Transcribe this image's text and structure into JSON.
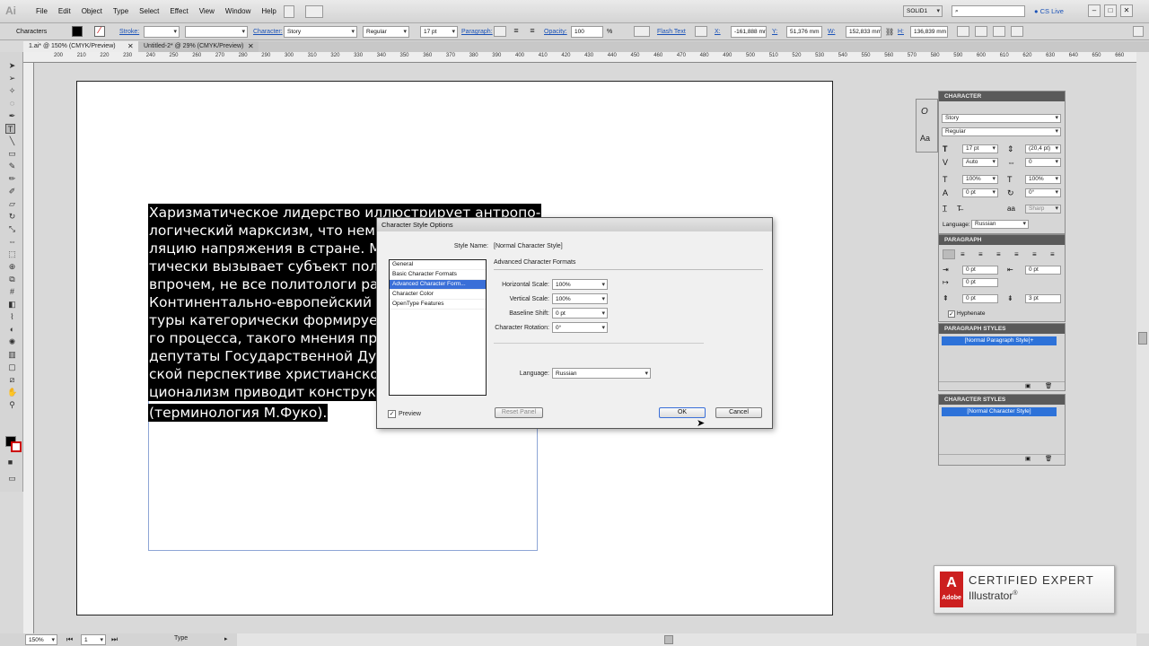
{
  "menubar": {
    "logo": "Ai",
    "items": [
      "File",
      "Edit",
      "Object",
      "Type",
      "Select",
      "Effect",
      "View",
      "Window",
      "Help"
    ],
    "workspace": "SOLID1",
    "cs_live": "CS Live"
  },
  "control": {
    "label": "Characters",
    "stroke": "Stroke:",
    "character": "Character:",
    "font": "Story",
    "style": "Regular",
    "size": "17 pt",
    "paragraph": "Paragraph:",
    "opacity_label": "Opacity:",
    "opacity": "100",
    "percent": "%",
    "flash_text": "Flash Text",
    "x_label": "X:",
    "x": "-161,888 mm",
    "y_label": "Y:",
    "y": "51,376 mm",
    "w_label": "W:",
    "w": "152,833 mm",
    "h_label": "H:",
    "h": "136,839 mm"
  },
  "tabs": [
    "1.ai* @ 150% (CMYK/Preview)",
    "Untitled-2* @ 29% (CMYK/Preview)"
  ],
  "ruler": [
    "200",
    "210",
    "220",
    "230",
    "240",
    "250",
    "260",
    "270",
    "280",
    "290",
    "300",
    "310",
    "320",
    "330",
    "340",
    "350",
    "360",
    "370",
    "380",
    "390",
    "400",
    "410",
    "420",
    "430",
    "440",
    "450",
    "460",
    "470",
    "480",
    "490",
    "500",
    "510",
    "520",
    "530",
    "540",
    "550",
    "560",
    "570",
    "580",
    "590",
    "600",
    "610",
    "620",
    "630",
    "640",
    "650",
    "660",
    "670"
  ],
  "artboard_text": [
    "Харизматическое лидерство иллюстрирует антропо-",
    "логический марксизм, что неми",
    "ляцию напряжения в стране. Ме",
    "тически вызывает субъект полит",
    "впрочем, не все политологи разд",
    "Континентально-европейский ти",
    "туры категорически формирует",
    "го процесса, такого мнения прид",
    "депутаты Государственной Дум",
    "ской перспективе христианско-д",
    "ционализм приводит конструкти",
    "(терминология М.Фуко)."
  ],
  "dialog": {
    "title": "Character Style Options",
    "style_name_label": "Style Name:",
    "style_name": "[Normal Character Style]",
    "section": "Advanced Character Formats",
    "list": [
      "General",
      "Basic Character Formats",
      "Advanced Character Form...",
      "Character Color",
      "OpenType Features"
    ],
    "h_scale_label": "Horizontal Scale:",
    "h_scale": "100%",
    "v_scale_label": "Vertical Scale:",
    "v_scale": "100%",
    "baseline_label": "Baseline Shift:",
    "baseline": "0 pt",
    "rotation_label": "Character Rotation:",
    "rotation": "0°",
    "language_label": "Language:",
    "language": "Russian",
    "preview": "Preview",
    "reset": "Reset Panel",
    "ok": "OK",
    "cancel": "Cancel"
  },
  "character_panel": {
    "title": "CHARACTER",
    "font": "Story",
    "style": "Regular",
    "size": "17 pt",
    "leading": "(20,4 pt)",
    "kerning": "Auto",
    "tracking": "0",
    "v_scale": "100%",
    "h_scale": "100%",
    "baseline": "0 pt",
    "rotation": "0°",
    "aa": "Sharp",
    "language_label": "Language:",
    "language": "Russian"
  },
  "paragraph_panel": {
    "title": "PARAGRAPH",
    "left_indent": "0 pt",
    "right_indent": "0 pt",
    "first_indent": "0 pt",
    "space_before": "0 pt",
    "space_after": "3 pt",
    "hyphenate": "Hyphenate"
  },
  "paragraph_styles": {
    "title": "PARAGRAPH STYLES",
    "item": "[Normal Paragraph Style]+"
  },
  "character_styles": {
    "title": "CHARACTER STYLES",
    "item": "[Normal Character Style]"
  },
  "status": {
    "zoom": "150%",
    "page": "1",
    "tool": "Type"
  },
  "badge": {
    "line1": "CERTIFIED EXPERT",
    "line2": "Illustrator",
    "mark": "®",
    "adobe": "Adobe"
  },
  "colors": {
    "selection": "#000000",
    "accent": "#2d72d9",
    "adobe_red": "#cc1f1f"
  }
}
